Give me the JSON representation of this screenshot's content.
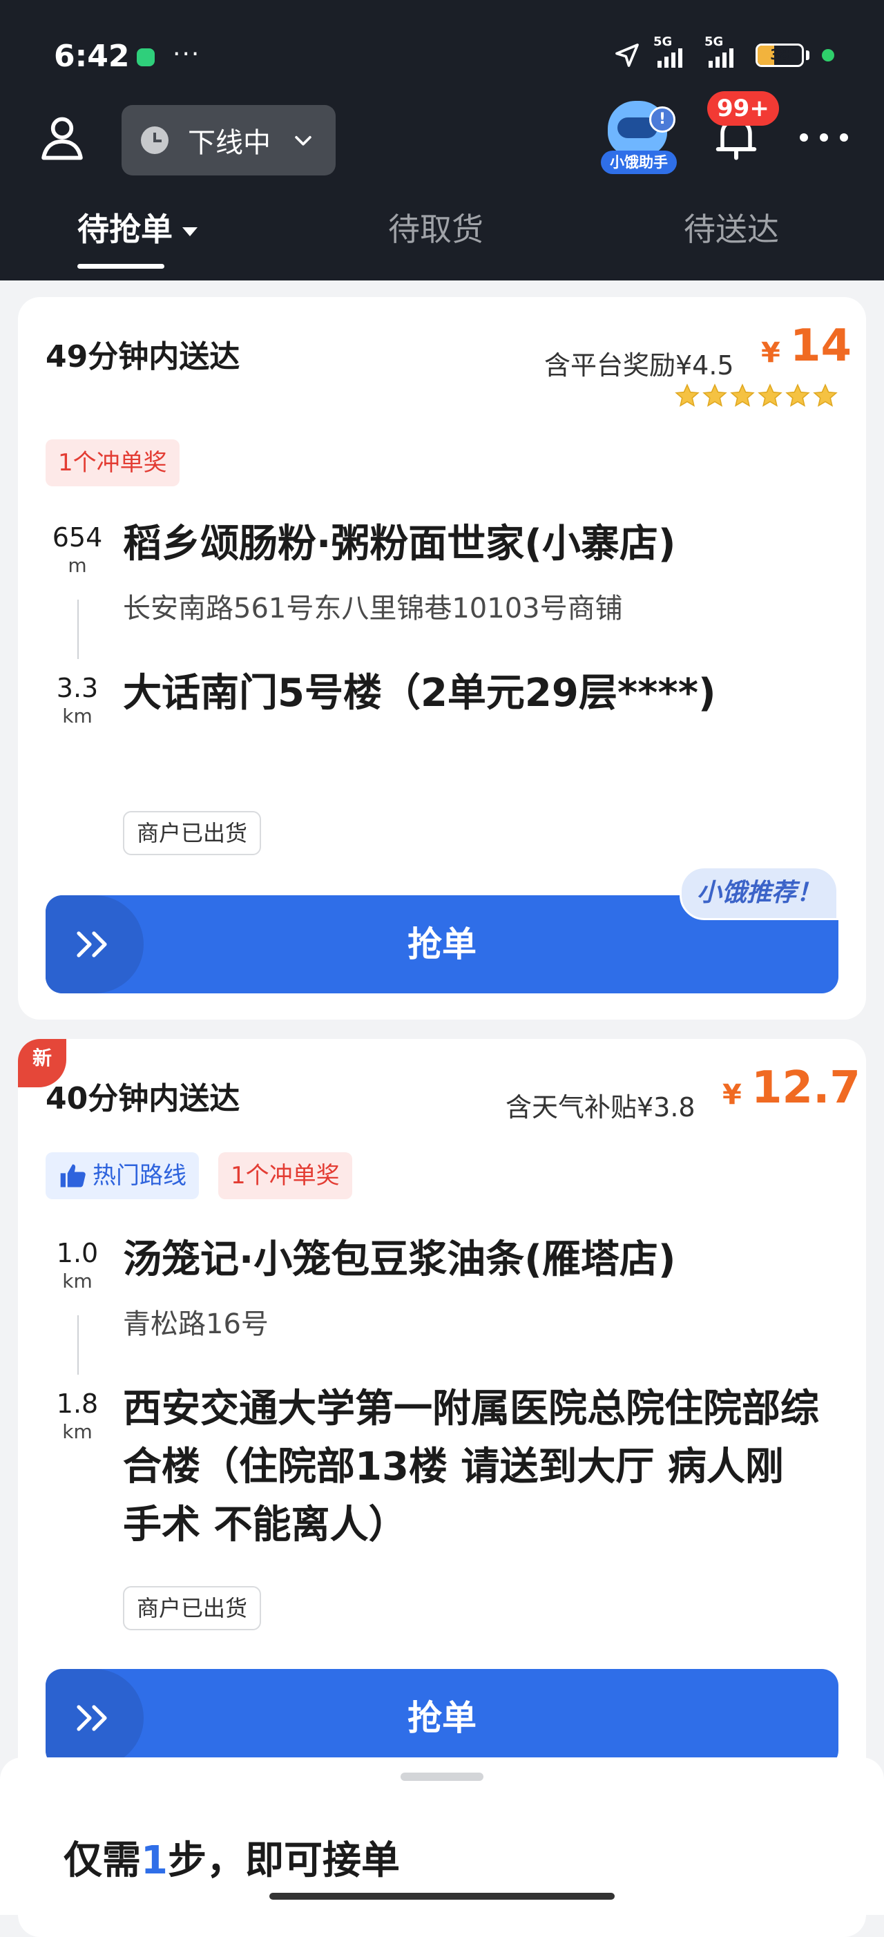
{
  "status_bar": {
    "time": "6:42",
    "overflow": "···",
    "network1": "5G",
    "network2": "5G",
    "battery": "38",
    "battery_level": 0.38
  },
  "header": {
    "online_status": "下线中",
    "assistant_label": "小饿助手",
    "assistant_badge": "!",
    "notification_count": "99+"
  },
  "tabs": [
    {
      "label": "待抢单",
      "active": true
    },
    {
      "label": "待取货",
      "active": false
    },
    {
      "label": "待送达",
      "active": false
    }
  ],
  "orders": [
    {
      "deliver_time": "49分钟内送达",
      "bonus_text": "含平台奖励¥4.5",
      "currency": "¥",
      "price": "14",
      "rating_stars": 6,
      "tags": [
        "1个冲单奖"
      ],
      "pickup_distance": "654",
      "pickup_unit": "m",
      "shop_name": "稻乡颂肠粉·粥粉面世家(小寨店)",
      "shop_address": "长安南路561号东八里锦巷10103号商铺",
      "dropoff_distance": "3.3",
      "dropoff_unit": "km",
      "destination": "大话南门5号楼（2单元29层****)",
      "status": "商户已出货",
      "recommend": "小饿推荐！",
      "grab_label": "抢单"
    },
    {
      "new_badge": "新",
      "deliver_time": "40分钟内送达",
      "bonus_text": "含天气补贴¥3.8",
      "currency": "¥",
      "price": "12.7",
      "tags": [
        "热门路线",
        "1个冲单奖"
      ],
      "pickup_distance": "1.0",
      "pickup_unit": "km",
      "shop_name": "汤笼记·小笼包豆浆油条(雁塔店)",
      "shop_address": "青松路16号",
      "dropoff_distance": "1.8",
      "dropoff_unit": "km",
      "destination": "西安交通大学第一附属医院总院住院部综合楼（住院部13楼 请送到大厅 病人刚手术 不能离人）",
      "status": "商户已出货",
      "grab_label": "抢单"
    }
  ],
  "bottom_sheet": {
    "title_prefix": "仅需",
    "title_highlight": "1",
    "title_suffix": "步，即可接单"
  },
  "colors": {
    "header_bg": "#1b1f27",
    "accent_blue": "#2f6ee8",
    "price_orange": "#f06a22",
    "tag_red": "#e33c33",
    "star_gold": "#f5c242"
  }
}
